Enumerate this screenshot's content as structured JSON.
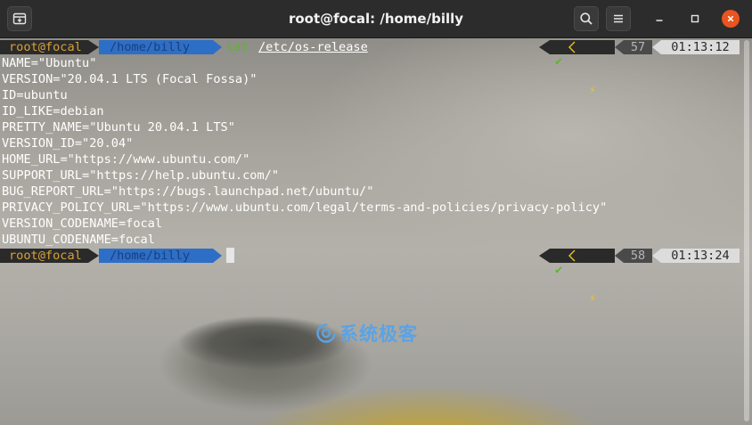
{
  "window": {
    "title": "root@focal: /home/billy"
  },
  "prompts": [
    {
      "user": "root@focal",
      "path": "/home/billy",
      "cmd_name": "cat",
      "cmd_arg": "/etc/os-release",
      "status_check": "✔",
      "status_bolt": "⚡",
      "history": "57",
      "time": "01:13:12"
    },
    {
      "user": "root@focal",
      "path": "/home/billy",
      "status_check": "✔",
      "status_bolt": "⚡",
      "history": "58",
      "time": "01:13:24"
    }
  ],
  "output_lines": [
    "NAME=\"Ubuntu\"",
    "VERSION=\"20.04.1 LTS (Focal Fossa)\"",
    "ID=ubuntu",
    "ID_LIKE=debian",
    "PRETTY_NAME=\"Ubuntu 20.04.1 LTS\"",
    "VERSION_ID=\"20.04\"",
    "HOME_URL=\"https://www.ubuntu.com/\"",
    "SUPPORT_URL=\"https://help.ubuntu.com/\"",
    "BUG_REPORT_URL=\"https://bugs.launchpad.net/ubuntu/\"",
    "PRIVACY_POLICY_URL=\"https://www.ubuntu.com/legal/terms-and-policies/privacy-policy\"",
    "VERSION_CODENAME=focal",
    "UBUNTU_CODENAME=focal"
  ],
  "watermark": {
    "text": "系统极客"
  },
  "colors": {
    "titlebar": "#2c2c2c",
    "close_button": "#e95420",
    "prompt_user": "#d9a238",
    "prompt_path_bg": "#2d6ec7",
    "prompt_path_fg": "#1d3f7a",
    "cmd_name": "#5fb336",
    "status_check": "#5fb336",
    "status_bolt": "#e8c230",
    "watermark": "#5aa3e6"
  },
  "icons": {
    "new_tab": "new-tab-icon",
    "search": "search-icon",
    "menu": "hamburger-menu-icon",
    "minimize": "minimize-icon",
    "maximize": "maximize-icon",
    "close": "close-icon",
    "watermark_logo": "swirl-logo-icon"
  }
}
